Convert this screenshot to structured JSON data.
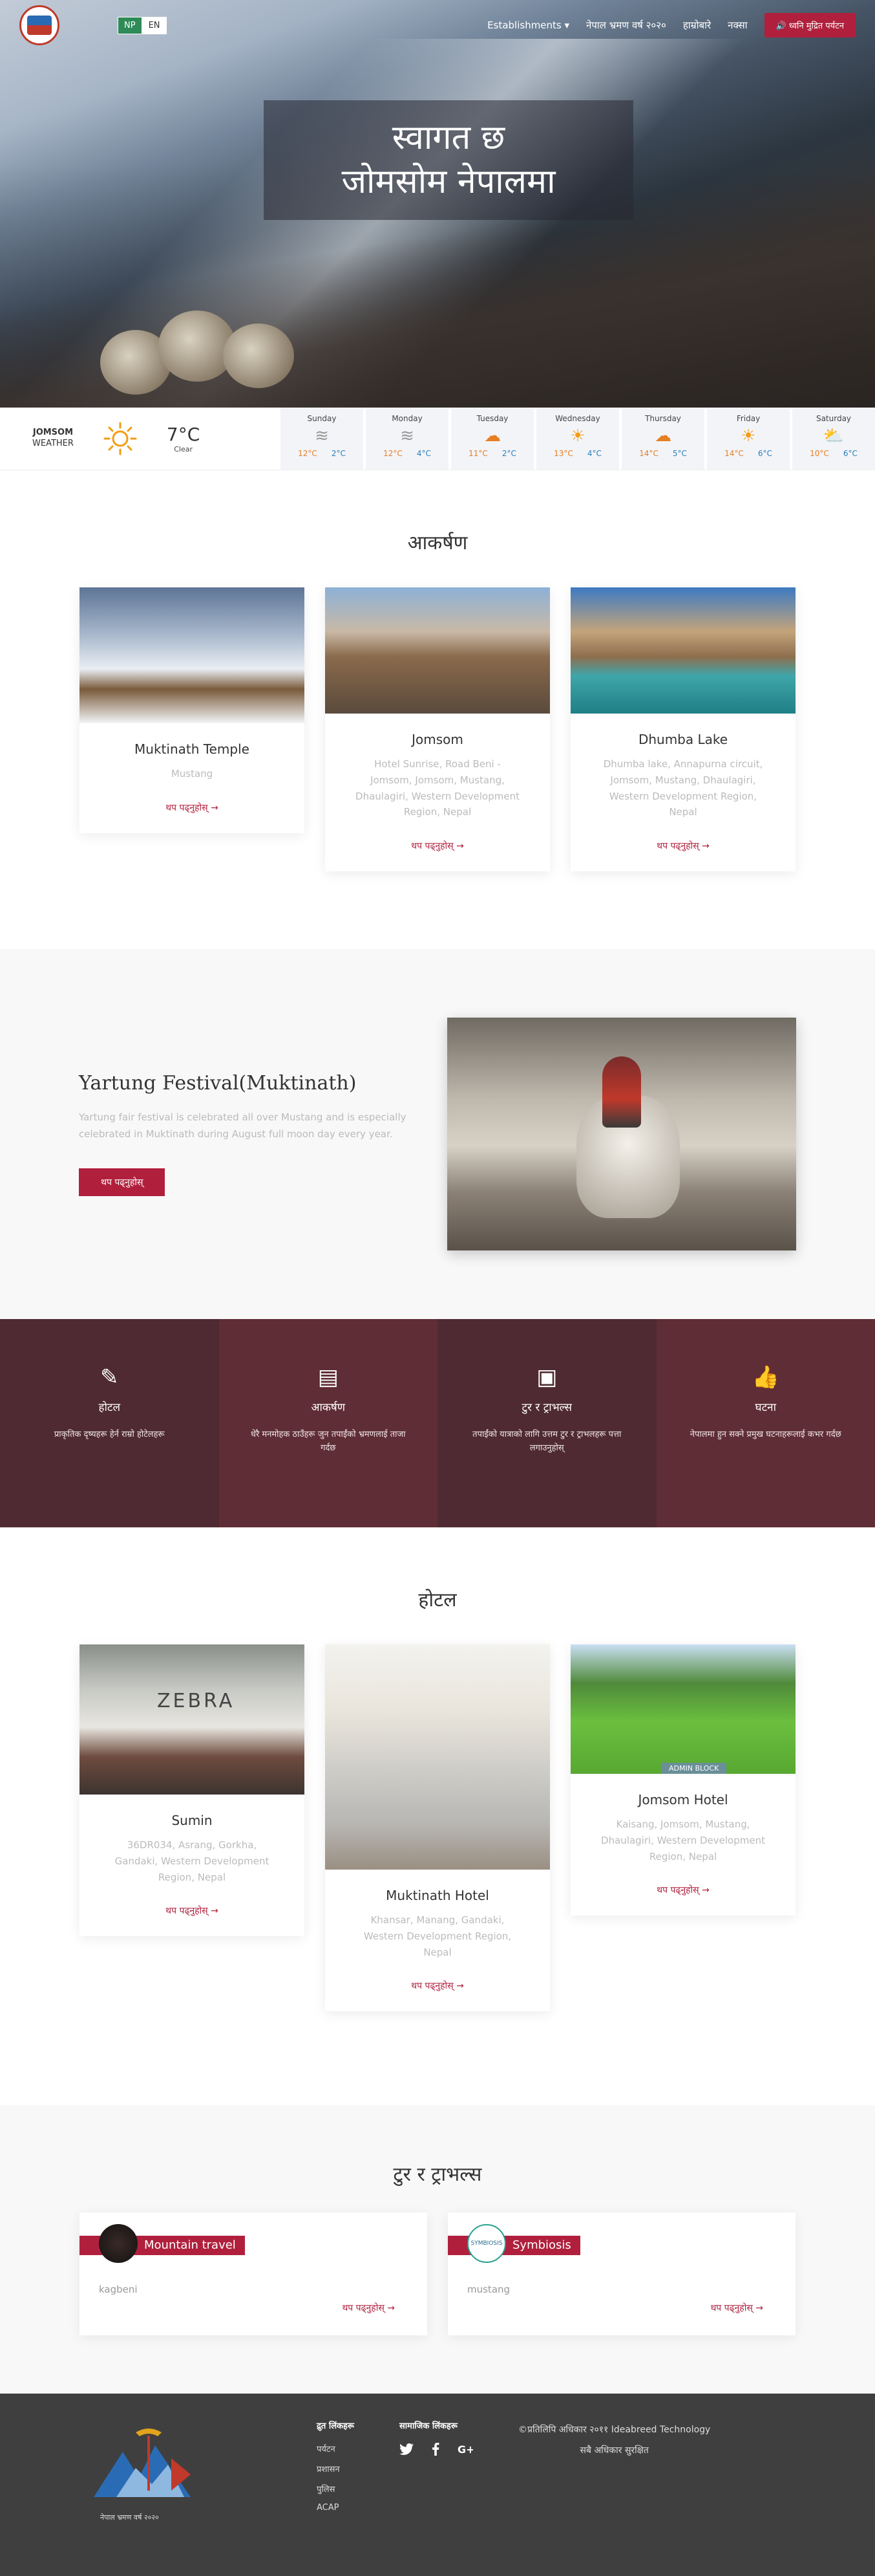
{
  "nav": {
    "lang_np": "NP",
    "lang_en": "EN",
    "menu": [
      "Establishments ▾",
      "नेपाल भ्रमण वर्ष २०२०",
      "हाम्रोबारे",
      "नक्सा"
    ],
    "cta": "🔊 ध्वनि मुद्रित पर्यटन"
  },
  "hero": {
    "line1": "स्वागत छ",
    "line2": "जोमसोम नेपालमा"
  },
  "weather": {
    "place": "JOMSOM",
    "label": "WEATHER",
    "now_temp": "7°C",
    "now_desc": "Clear",
    "days": [
      {
        "name": "Sunday",
        "icon": "fog-icon",
        "glyph": "≋",
        "hi": "12°C",
        "lo": "2°C"
      },
      {
        "name": "Monday",
        "icon": "fog-icon",
        "glyph": "≋",
        "hi": "12°C",
        "lo": "4°C"
      },
      {
        "name": "Tuesday",
        "icon": "cloudy-icon",
        "glyph": "☁",
        "hi": "11°C",
        "lo": "2°C"
      },
      {
        "name": "Wednesday",
        "icon": "sun-icon",
        "glyph": "☀",
        "hi": "13°C",
        "lo": "4°C"
      },
      {
        "name": "Thursday",
        "icon": "cloudy-icon",
        "glyph": "☁",
        "hi": "14°C",
        "lo": "5°C"
      },
      {
        "name": "Friday",
        "icon": "sun-icon",
        "glyph": "☀",
        "hi": "14°C",
        "lo": "6°C"
      },
      {
        "name": "Saturday",
        "icon": "cloudy-sun-icon",
        "glyph": "⛅",
        "hi": "10°C",
        "lo": "6°C"
      }
    ]
  },
  "attractions": {
    "title": "आकर्षण",
    "items": [
      {
        "name": "Muktinath Temple",
        "addr": "Mustang",
        "more": "थप पढ्नुहोस् →"
      },
      {
        "name": "Jomsom",
        "addr": "Hotel Sunrise, Road Beni - Jomsom, Jomsom, Mustang, Dhaulagiri, Western Development Region, Nepal",
        "more": "थप पढ्नुहोस् →"
      },
      {
        "name": "Dhumba Lake",
        "addr": "Dhumba lake, Annapurna circuit, Jomsom, Mustang, Dhaulagiri, Western Development Region, Nepal",
        "more": "थप पढ्नुहोस् →"
      }
    ]
  },
  "festival": {
    "title": "Yartung Festival(Muktinath)",
    "desc": "Yartung fair festival is celebrated all over Mustang and is especially celebrated in Muktinath during August full moon day every year.",
    "btn": "थप पढ्नुहोस्"
  },
  "features": [
    {
      "icon": "edit-icon",
      "glyph": "✎",
      "title": "होटल",
      "desc": "प्राकृतिक दृष्यहरू हेर्न राम्रो होटेलहरू",
      "color": "#4f2a32"
    },
    {
      "icon": "card-icon",
      "glyph": "▤",
      "title": "आकर्षण",
      "desc": "धेरै मनमोहक ठाउँहरू जुन तपाईंको भ्रमणलाई ताजा गर्दछ",
      "color": "#5f2d35"
    },
    {
      "icon": "image-icon",
      "glyph": "▣",
      "title": "टुर र ट्राभल्स",
      "desc": "तपाईंको यात्राको लागि उत्तम टुर र ट्राभलहरू पत्ता लगाउनुहोस्",
      "color": "#4f2a32"
    },
    {
      "icon": "thumbs-up-icon",
      "glyph": "👍",
      "title": "घटना",
      "desc": "नेपालमा हुन सक्ने प्रमुख घटनाहरूलाई कभर गर्दछ",
      "color": "#5f2d35"
    }
  ],
  "hotels": {
    "title": "होटल",
    "items": [
      {
        "name": "Sumin",
        "addr": "36DR034, Asrang, Gorkha, Gandaki, Western Development Region, Nepal",
        "more": "थप पढ्नुहोस् →"
      },
      {
        "name": "Muktinath Hotel",
        "addr": "Khansar, Manang, Gandaki, Western Development Region, Nepal",
        "more": "थप पढ्नुहोस् →"
      },
      {
        "name": "Jomsom Hotel",
        "addr": "Kaisang, Jomsom, Mustang, Dhaulagiri, Western Development Region, Nepal",
        "more": "थप पढ्नुहोस् →"
      }
    ],
    "sign": "ADMIN BLOCK",
    "zebra": "ZEBRA"
  },
  "tours": {
    "title": "टुर र ट्राभल्स",
    "items": [
      {
        "name": "Mountain travel",
        "loc": "kagbeni",
        "more": "थप पढ्नुहोस् →"
      },
      {
        "name": "Symbiosis",
        "loc": "mustang",
        "more": "थप पढ्नुहोस् →"
      }
    ],
    "logo_text": "SYMBIOSIS"
  },
  "footer": {
    "logo_text": "नेपाल भ्रमण वर्ष २०२०",
    "links_title": "द्रुत लिंकहरू",
    "links": [
      "पर्यटन",
      "प्रशासन",
      "पुलिस",
      "ACAP"
    ],
    "social_title": "सामाजिक लिंकहरू",
    "copyright": "©प्रतिलिपि अधिकार २०११ Ideabreed Technology",
    "rights": "सबै अधिकार सुरक्षित"
  }
}
